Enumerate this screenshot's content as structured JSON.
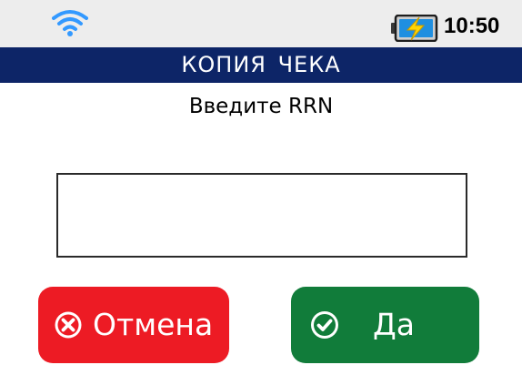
{
  "status_bar": {
    "wifi_icon": "wifi-icon",
    "battery_icon": "battery-charging-icon",
    "time": "10:50"
  },
  "header": {
    "title": "КОПИЯ ЧЕКА"
  },
  "main": {
    "prompt": "Введите RRN",
    "rrn_input": {
      "value": "",
      "placeholder": ""
    }
  },
  "buttons": {
    "cancel": {
      "label": "Отмена",
      "icon": "cancel-circle-icon",
      "color": "#ed1b24"
    },
    "ok": {
      "label": "Да",
      "icon": "check-circle-icon",
      "color": "#117c3a"
    }
  },
  "colors": {
    "header_bg": "#0d2567",
    "status_bg": "#ededed",
    "wifi": "#3399ff",
    "battery_charge": "#ffd400"
  }
}
